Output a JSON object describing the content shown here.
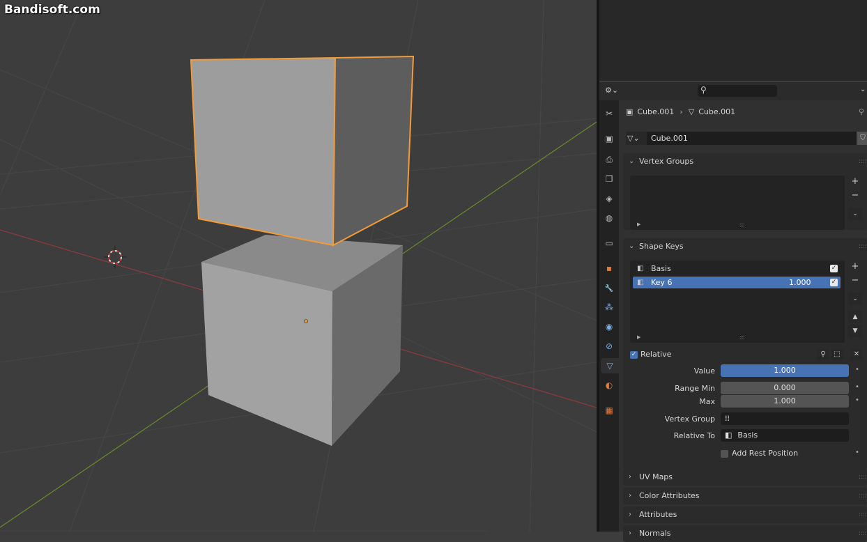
{
  "watermark": "Bandisoft.com",
  "header": {
    "editor_icon": "properties-editor-icon",
    "search_placeholder": "",
    "dropdown": "⌄"
  },
  "breadcrumb": {
    "object": "Cube.001",
    "mesh": "Cube.001"
  },
  "mesh_datablock": {
    "name": "Cube.001"
  },
  "tabs": [
    {
      "name": "tool-tab",
      "glyph": "✂"
    },
    {
      "name": "render-tab",
      "glyph": "▣"
    },
    {
      "name": "output-tab",
      "glyph": "⎙"
    },
    {
      "name": "view-layer-tab",
      "glyph": "❐"
    },
    {
      "name": "scene-tab",
      "glyph": "◈"
    },
    {
      "name": "world-tab",
      "glyph": "◍"
    },
    {
      "name": "collection-tab",
      "glyph": "▭"
    },
    {
      "name": "object-tab",
      "glyph": "▪"
    },
    {
      "name": "modifier-tab",
      "glyph": "🔧"
    },
    {
      "name": "particles-tab",
      "glyph": "⁂"
    },
    {
      "name": "physics-tab",
      "glyph": "◉"
    },
    {
      "name": "constraints-tab",
      "glyph": "⊘"
    },
    {
      "name": "data-tab",
      "glyph": "▽"
    },
    {
      "name": "material-tab",
      "glyph": "◐"
    },
    {
      "name": "texture-tab",
      "glyph": "▦"
    }
  ],
  "vertex_groups": {
    "title": "Vertex Groups"
  },
  "shape_keys": {
    "title": "Shape Keys",
    "items": [
      {
        "name": "Basis",
        "value": "",
        "checked": true
      },
      {
        "name": "Key 6",
        "value": "1.000",
        "checked": true
      }
    ],
    "relative_label": "Relative",
    "value_label": "Value",
    "value": "1.000",
    "value_fill": 1.0,
    "range_min_label": "Range Min",
    "range_min": "0.000",
    "max_label": "Max",
    "max": "1.000",
    "vertex_group_label": "Vertex Group",
    "vertex_group": "",
    "relative_to_label": "Relative To",
    "relative_to": "Basis",
    "add_rest_label": "Add Rest Position"
  },
  "closed_panels": [
    {
      "title": "UV Maps"
    },
    {
      "title": "Color Attributes"
    },
    {
      "title": "Attributes"
    },
    {
      "title": "Normals"
    }
  ],
  "colors": {
    "accent_blue": "#4772b3",
    "selection_outline": "#f39b37",
    "x_axis": "#8f3b3b",
    "y_axis": "#6a8a2c"
  }
}
